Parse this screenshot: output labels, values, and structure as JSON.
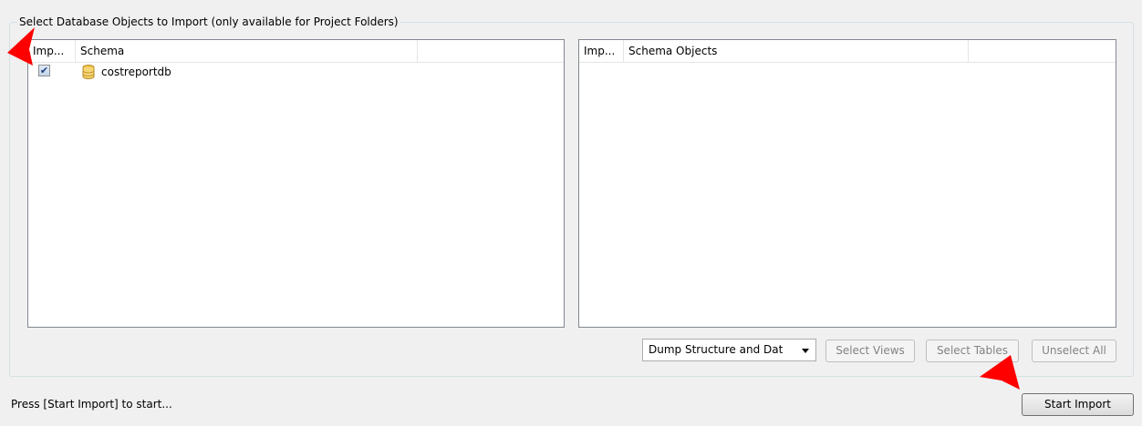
{
  "group": {
    "title": "Select Database Objects to Import (only available for Project Folders)"
  },
  "left_table": {
    "columns": [
      "Imp...",
      "Schema"
    ],
    "rows": [
      {
        "checked": true,
        "check_glyph": "✔",
        "icon": "database-icon",
        "label": "costreportdb"
      }
    ]
  },
  "right_table": {
    "columns": [
      "Imp...",
      "Schema Objects"
    ],
    "rows": []
  },
  "dump_select": {
    "value": "Dump Structure and Dat"
  },
  "buttons": {
    "select_views": "Select Views",
    "select_tables": "Select Tables",
    "unselect_all": "Unselect All",
    "start_import": "Start Import"
  },
  "status": {
    "text": "Press [Start Import] to start..."
  },
  "colors": {
    "annotation_arrow": "#ff0000",
    "database_icon": "#f3c24d"
  }
}
